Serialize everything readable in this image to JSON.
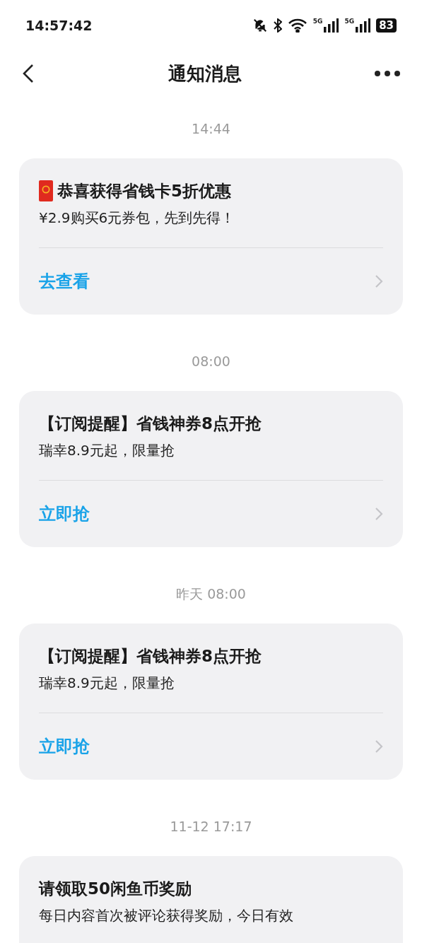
{
  "status_bar": {
    "time": "14:57:42",
    "network_labels": [
      "5G",
      "5G"
    ],
    "battery": "83"
  },
  "nav": {
    "title": "通知消息"
  },
  "messages": [
    {
      "time": "14:44",
      "kind": "gift",
      "title": "恭喜获得省钱卡5折优惠",
      "subtitle": "¥2.9购买6元券包，先到先得！",
      "action": "去查看"
    },
    {
      "time": "08:00",
      "kind": "notice",
      "title": "【订阅提醒】省钱神券8点开抢",
      "subtitle": "瑞幸8.9元起，限量抢",
      "action": "立即抢"
    },
    {
      "time": "昨天 08:00",
      "kind": "notice",
      "title": "【订阅提醒】省钱神券8点开抢",
      "subtitle": "瑞幸8.9元起，限量抢",
      "action": "立即抢"
    },
    {
      "time": "11-12 17:17",
      "kind": "notice",
      "title": "请领取50闲鱼币奖励",
      "subtitle": "每日内容首次被评论获得奖励，今日有效"
    }
  ]
}
